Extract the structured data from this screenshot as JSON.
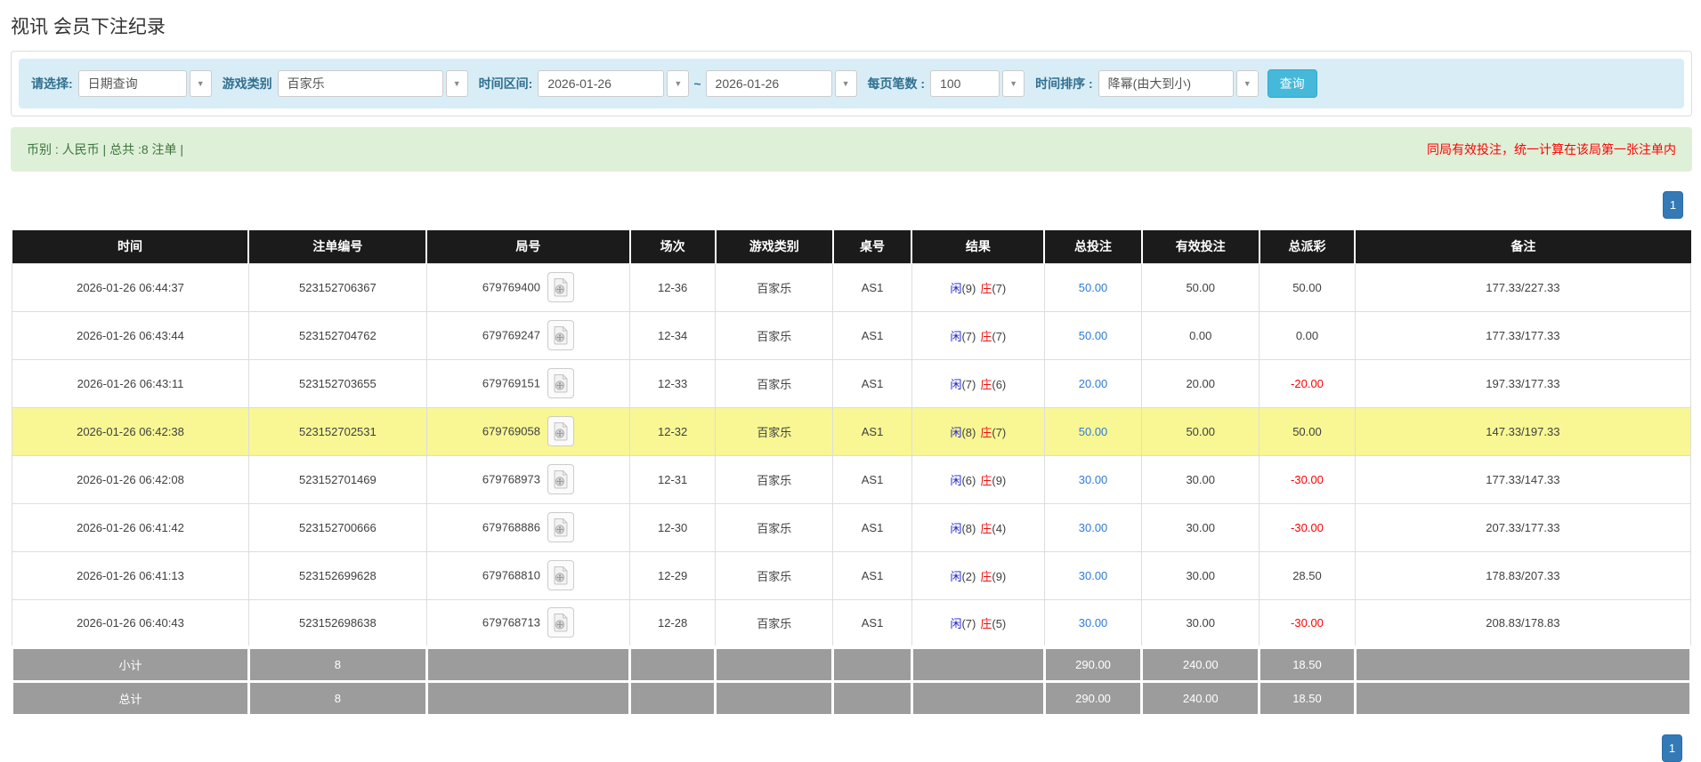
{
  "page": {
    "title": "视讯 会员下注纪录"
  },
  "filters": {
    "select_label": "请选择:",
    "select_value": "日期查询",
    "game_type_label": "游戏类别",
    "game_type_value": "百家乐",
    "time_range_label": "时间区间:",
    "date_from": "2026-01-26",
    "date_separator": "~",
    "date_to": "2026-01-26",
    "page_size_label": "每页笔数 :",
    "page_size_value": "100",
    "sort_label": "时间排序 :",
    "sort_value": "降幂(由大到小)",
    "search_button": "查询"
  },
  "summary": {
    "left_text": "币别 : 人民币 | 总共 :8 注单 |",
    "right_text": "同局有效投注，统一计算在该局第一张注单内"
  },
  "pagination": {
    "page": "1"
  },
  "colors": {
    "accent_blue": "#337ab7",
    "info_button": "#46b8da",
    "highlight_row": "#f8f794",
    "player_blue": "#2222cc",
    "banker_red": "#ee1111",
    "negative_red": "#ff0000",
    "footer_gray": "#9c9c9c"
  },
  "table": {
    "headers": [
      "时间",
      "注单编号",
      "局号",
      "场次",
      "游戏类别",
      "桌号",
      "结果",
      "总投注",
      "有效投注",
      "总派彩",
      "备注"
    ],
    "rows": [
      {
        "time": "2026-01-26 06:44:37",
        "bet_id": "523152706367",
        "round_id": "679769400",
        "session": "12-36",
        "game": "百家乐",
        "table_id": "AS1",
        "result": {
          "player_label": "闲",
          "player_score": "(9)",
          "banker_label": "庄",
          "banker_score": "(7)"
        },
        "total_bet": "50.00",
        "valid_bet": "50.00",
        "payout": "50.00",
        "remark": "177.33/227.33",
        "highlight": false
      },
      {
        "time": "2026-01-26 06:43:44",
        "bet_id": "523152704762",
        "round_id": "679769247",
        "session": "12-34",
        "game": "百家乐",
        "table_id": "AS1",
        "result": {
          "player_label": "闲",
          "player_score": "(7)",
          "banker_label": "庄",
          "banker_score": "(7)"
        },
        "total_bet": "50.00",
        "valid_bet": "0.00",
        "payout": "0.00",
        "remark": "177.33/177.33",
        "highlight": false
      },
      {
        "time": "2026-01-26 06:43:11",
        "bet_id": "523152703655",
        "round_id": "679769151",
        "session": "12-33",
        "game": "百家乐",
        "table_id": "AS1",
        "result": {
          "player_label": "闲",
          "player_score": "(7)",
          "banker_label": "庄",
          "banker_score": "(6)"
        },
        "total_bet": "20.00",
        "valid_bet": "20.00",
        "payout": "-20.00",
        "remark": "197.33/177.33",
        "highlight": false
      },
      {
        "time": "2026-01-26 06:42:38",
        "bet_id": "523152702531",
        "round_id": "679769058",
        "session": "12-32",
        "game": "百家乐",
        "table_id": "AS1",
        "result": {
          "player_label": "闲",
          "player_score": "(8)",
          "banker_label": "庄",
          "banker_score": "(7)"
        },
        "total_bet": "50.00",
        "valid_bet": "50.00",
        "payout": "50.00",
        "remark": "147.33/197.33",
        "highlight": true
      },
      {
        "time": "2026-01-26 06:42:08",
        "bet_id": "523152701469",
        "round_id": "679768973",
        "session": "12-31",
        "game": "百家乐",
        "table_id": "AS1",
        "result": {
          "player_label": "闲",
          "player_score": "(6)",
          "banker_label": "庄",
          "banker_score": "(9)"
        },
        "total_bet": "30.00",
        "valid_bet": "30.00",
        "payout": "-30.00",
        "remark": "177.33/147.33",
        "highlight": false
      },
      {
        "time": "2026-01-26 06:41:42",
        "bet_id": "523152700666",
        "round_id": "679768886",
        "session": "12-30",
        "game": "百家乐",
        "table_id": "AS1",
        "result": {
          "player_label": "闲",
          "player_score": "(8)",
          "banker_label": "庄",
          "banker_score": "(4)"
        },
        "total_bet": "30.00",
        "valid_bet": "30.00",
        "payout": "-30.00",
        "remark": "207.33/177.33",
        "highlight": false
      },
      {
        "time": "2026-01-26 06:41:13",
        "bet_id": "523152699628",
        "round_id": "679768810",
        "session": "12-29",
        "game": "百家乐",
        "table_id": "AS1",
        "result": {
          "player_label": "闲",
          "player_score": "(2)",
          "banker_label": "庄",
          "banker_score": "(9)"
        },
        "total_bet": "30.00",
        "valid_bet": "30.00",
        "payout": "28.50",
        "remark": "178.83/207.33",
        "highlight": false
      },
      {
        "time": "2026-01-26 06:40:43",
        "bet_id": "523152698638",
        "round_id": "679768713",
        "session": "12-28",
        "game": "百家乐",
        "table_id": "AS1",
        "result": {
          "player_label": "闲",
          "player_score": "(7)",
          "banker_label": "庄",
          "banker_score": "(5)"
        },
        "total_bet": "30.00",
        "valid_bet": "30.00",
        "payout": "-30.00",
        "remark": "208.83/178.83",
        "highlight": false
      }
    ],
    "footer": [
      {
        "label": "小计",
        "count": "8",
        "total_bet": "290.00",
        "valid_bet": "240.00",
        "payout": "18.50"
      },
      {
        "label": "总计",
        "count": "8",
        "total_bet": "290.00",
        "valid_bet": "240.00",
        "payout": "18.50"
      }
    ]
  }
}
